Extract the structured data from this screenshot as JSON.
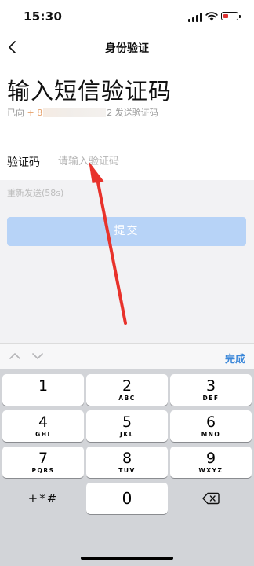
{
  "status_bar": {
    "time": "15:30"
  },
  "nav": {
    "title": "身份验证"
  },
  "header": {
    "title": "输入短信验证码",
    "sent_prefix": "已向",
    "phone_start": "+ 8",
    "phone_end": "2",
    "sent_suffix": "发送验证码"
  },
  "form": {
    "code_label": "验证码",
    "code_placeholder": "请输入验证码",
    "code_value": "",
    "resend": "重新发送(58s)",
    "submit": "提交"
  },
  "keyboard_toolbar": {
    "done": "完成"
  },
  "keyboard": {
    "keys": [
      {
        "num": "1",
        "letters": ""
      },
      {
        "num": "2",
        "letters": "ABC"
      },
      {
        "num": "3",
        "letters": "DEF"
      },
      {
        "num": "4",
        "letters": "GHI"
      },
      {
        "num": "5",
        "letters": "JKL"
      },
      {
        "num": "6",
        "letters": "MNO"
      },
      {
        "num": "7",
        "letters": "PQRS"
      },
      {
        "num": "8",
        "letters": "TUV"
      },
      {
        "num": "9",
        "letters": "WXYZ"
      },
      {
        "num": "0",
        "letters": ""
      }
    ],
    "symbols": "+*#"
  },
  "annotation": {
    "arrow_color": "#e8322b"
  }
}
